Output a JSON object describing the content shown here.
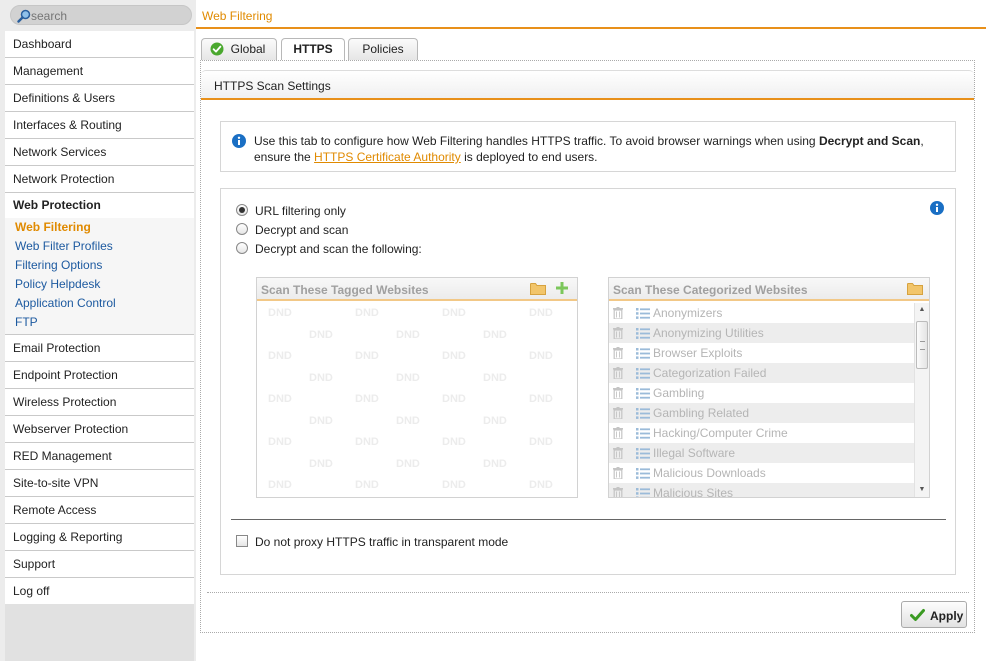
{
  "search": {
    "placeholder": "search"
  },
  "sidebar": {
    "items_top": [
      "Dashboard",
      "Management",
      "Definitions & Users",
      "Interfaces & Routing",
      "Network Services",
      "Network Protection"
    ],
    "active_section": "Web Protection",
    "sub_items": [
      "Web Filtering",
      "Web Filter Profiles",
      "Filtering Options",
      "Policy Helpdesk",
      "Application Control",
      "FTP"
    ],
    "current_sub_item": "Web Filtering",
    "items_bottom": [
      "Email Protection",
      "Endpoint Protection",
      "Wireless Protection",
      "Webserver Protection",
      "RED Management",
      "Site-to-site VPN",
      "Remote Access",
      "Logging & Reporting",
      "Support",
      "Log off"
    ]
  },
  "page": {
    "title": "Web Filtering"
  },
  "tabs": {
    "global": "Global",
    "https": "HTTPS",
    "policies": "Policies",
    "active": "HTTPS"
  },
  "panel": {
    "title": "HTTPS Scan Settings"
  },
  "info": {
    "text_1": "Use this tab to configure how Web Filtering handles HTTPS traffic. To avoid browser warnings when using ",
    "text_bold": "Decrypt and Scan",
    "text_2": ", ensure the ",
    "link": "HTTPS Certificate Authority",
    "text_3": " is deployed to end users."
  },
  "mode_options": {
    "url_only": "URL filtering only",
    "decrypt_scan": "Decrypt and scan",
    "decrypt_following": "Decrypt and scan the following:",
    "selected": "URL filtering only"
  },
  "tagged_websites": {
    "title": "Scan These Tagged Websites",
    "placeholder_text": "DND"
  },
  "categorized_websites": {
    "title": "Scan These Categorized Websites",
    "items": [
      "Anonymizers",
      "Anonymizing Utilities",
      "Browser Exploits",
      "Categorization Failed",
      "Gambling",
      "Gambling Related",
      "Hacking/Computer Crime",
      "Illegal Software",
      "Malicious Downloads",
      "Malicious Sites"
    ]
  },
  "transparent_option": {
    "label": "Do not proxy HTTPS traffic in transparent mode",
    "checked": false
  },
  "apply_button": {
    "label": "Apply"
  },
  "colors": {
    "accent": "#e8901a",
    "link": "#1d5aa0",
    "info_icon": "#1a6fc4",
    "apply_check": "#3a9a22"
  }
}
